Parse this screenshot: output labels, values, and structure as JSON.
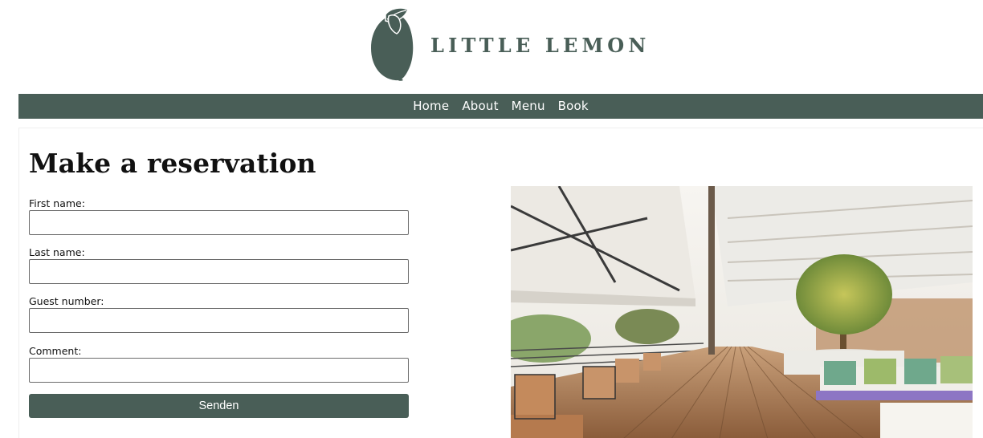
{
  "brand": {
    "name": "LITTLE LEMON",
    "color": "#495e57"
  },
  "nav": {
    "items": [
      {
        "label": "Home"
      },
      {
        "label": "About"
      },
      {
        "label": "Menu"
      },
      {
        "label": "Book"
      }
    ]
  },
  "page": {
    "title": "Make a reservation"
  },
  "form": {
    "first_name": {
      "label": "First name:",
      "value": "",
      "placeholder": ""
    },
    "last_name": {
      "label": "Last name:",
      "value": "",
      "placeholder": ""
    },
    "guests": {
      "label": "Guest number:",
      "value": "",
      "placeholder": ""
    },
    "comment": {
      "label": "Comment:",
      "value": "",
      "placeholder": ""
    },
    "submit_label": "Senden"
  },
  "image": {
    "subject": "restaurant-terrace-photo"
  }
}
